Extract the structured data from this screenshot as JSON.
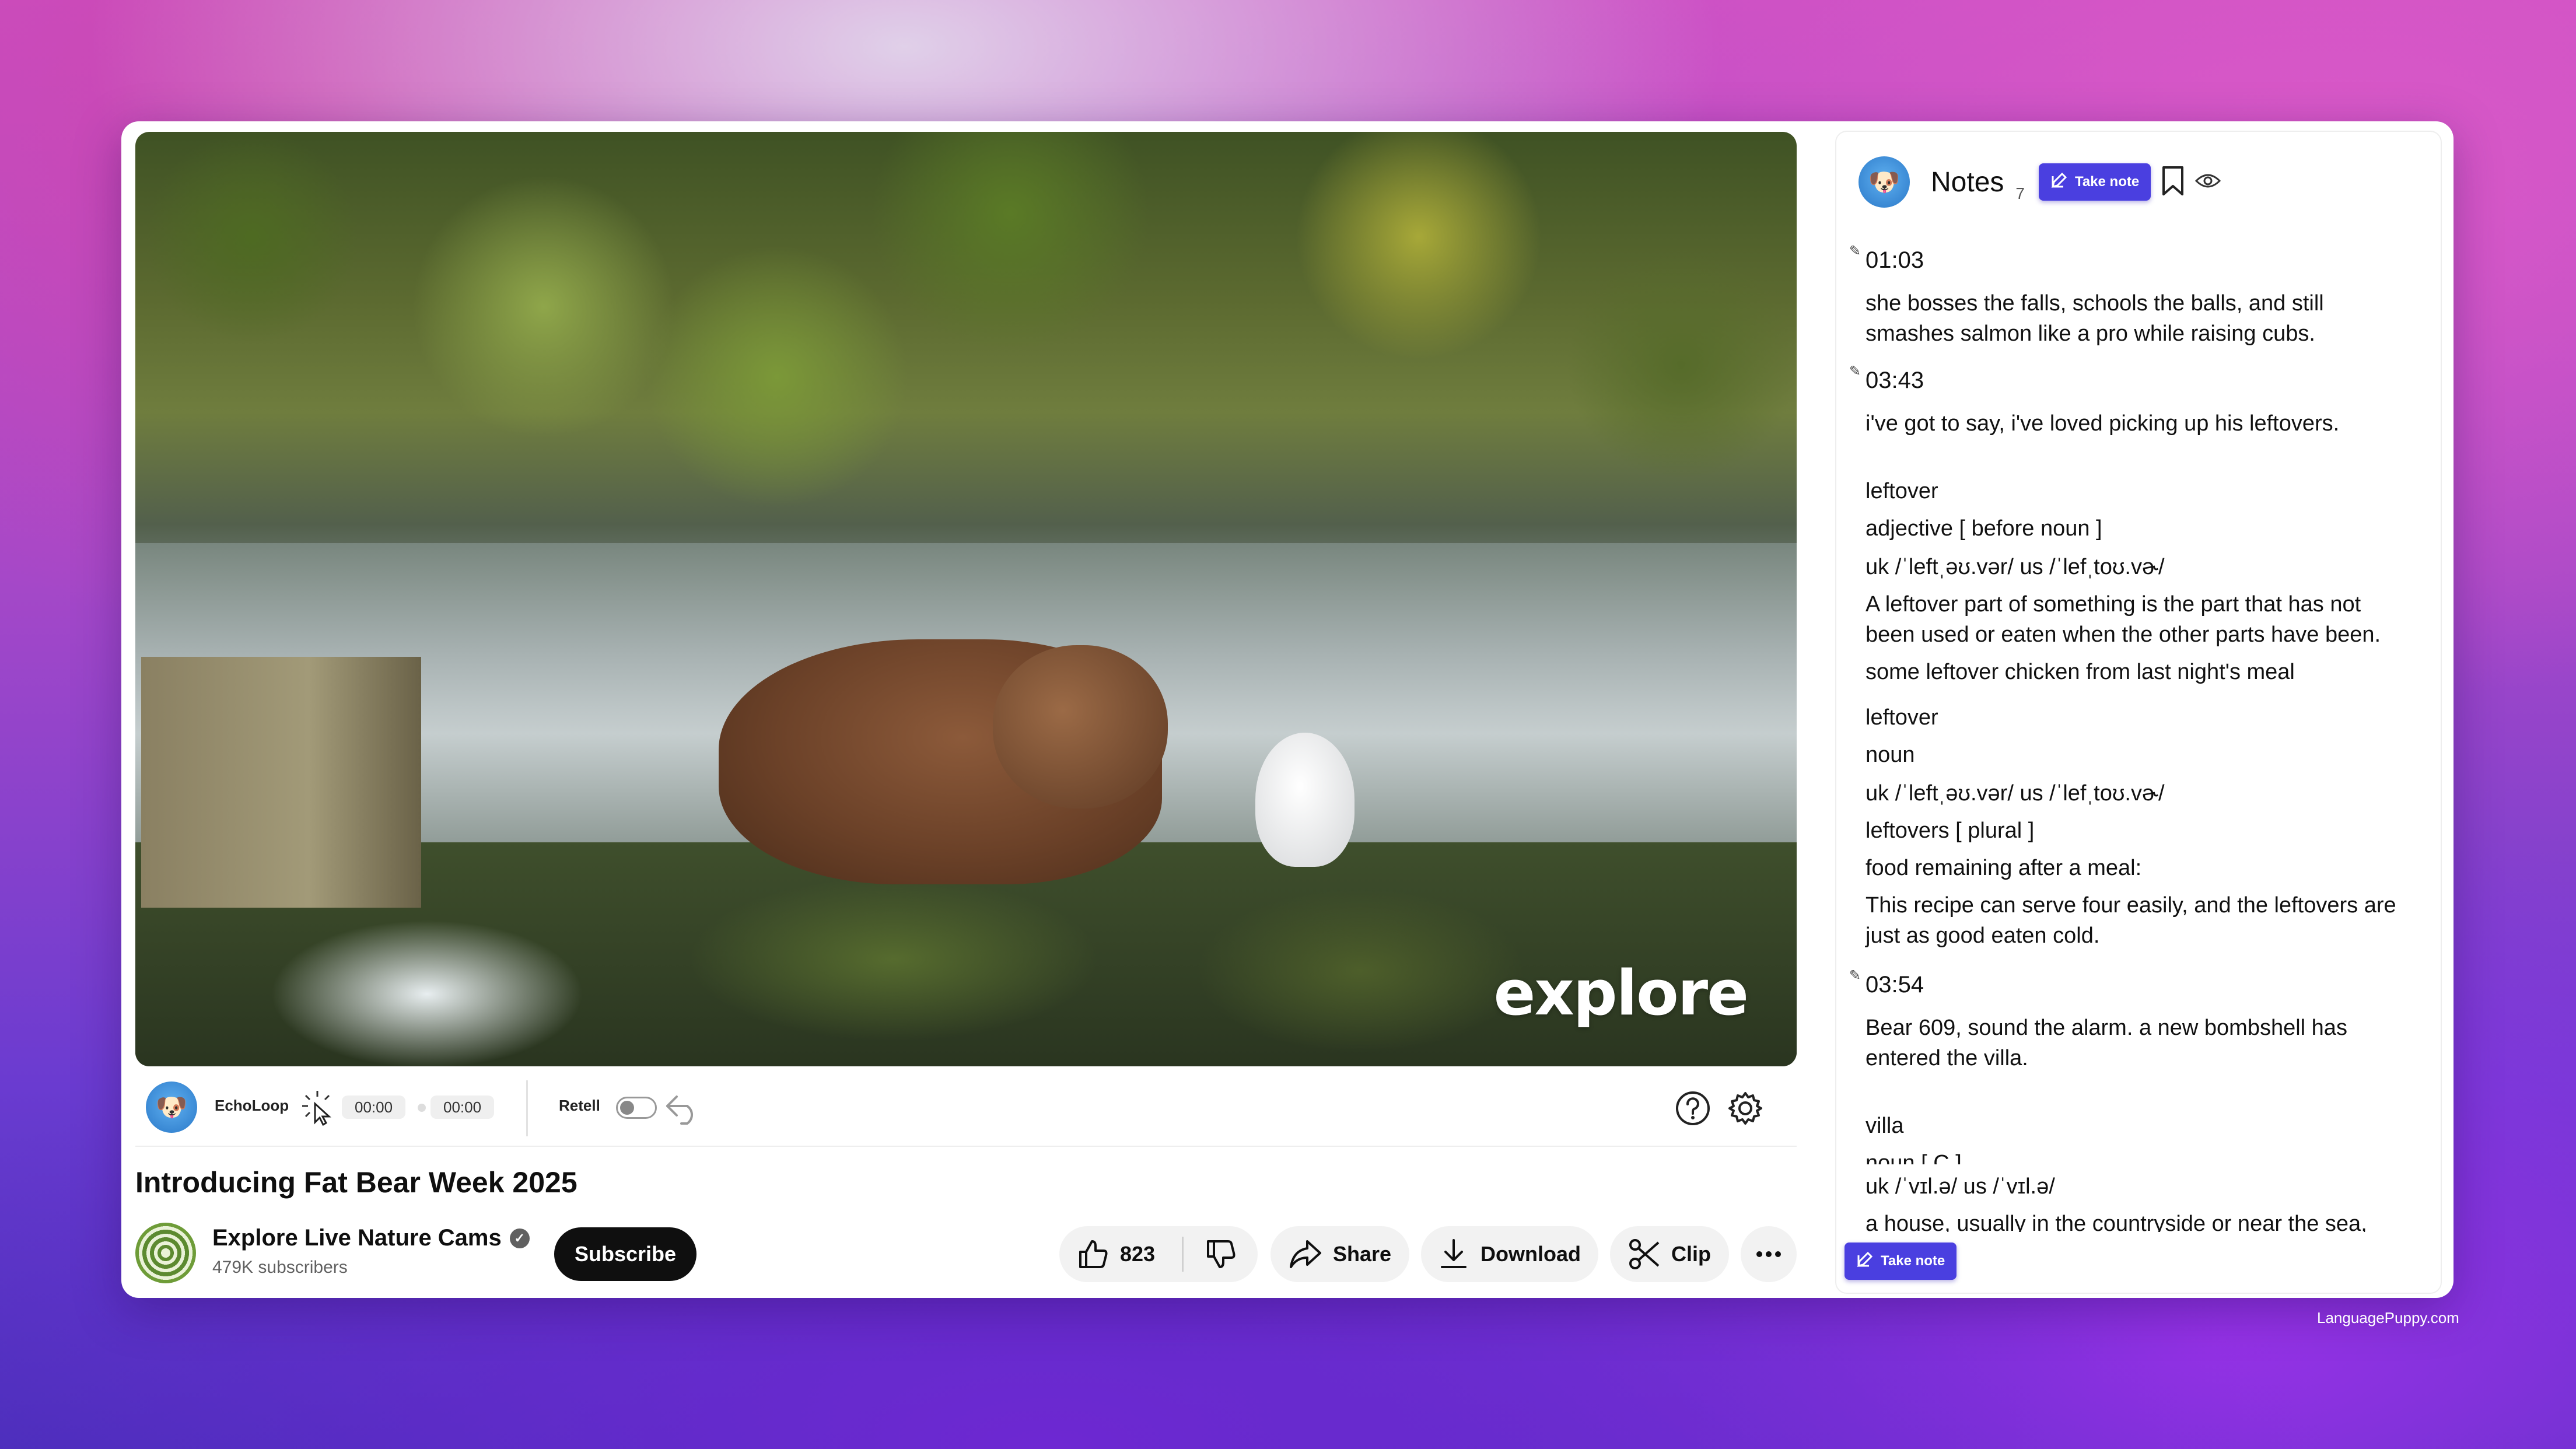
{
  "player": {
    "watermark": "explore",
    "echoloop_label": "EchoLoop",
    "time_start": "00:00",
    "time_end": "00:00",
    "retell_label": "Retell"
  },
  "video": {
    "title": "Introducing Fat Bear Week 2025"
  },
  "channel": {
    "name": "Explore Live Nature Cams",
    "subscribers": "479K subscribers",
    "subscribe_label": "Subscribe"
  },
  "actions": {
    "like_count": "823",
    "share_label": "Share",
    "download_label": "Download",
    "clip_label": "Clip"
  },
  "notes": {
    "title": "Notes",
    "count": "7",
    "take_note_label": "Take note",
    "entries": [
      {
        "type": "ts",
        "text": "01:03"
      },
      {
        "type": "line",
        "text": "she bosses the falls, schools the balls, and still"
      },
      {
        "type": "line",
        "text": "smashes salmon like a pro while raising cubs."
      },
      {
        "type": "ts",
        "text": "03:43"
      },
      {
        "type": "line",
        "text": "i've got to say, i've loved picking up his leftovers."
      },
      {
        "type": "line",
        "text": "leftover"
      },
      {
        "type": "line",
        "text": "adjective [ before noun ]"
      },
      {
        "type": "line",
        "text": "uk /ˈleftˌəʊ.vər/ us /ˈlefˌtoʊ.vɚ/"
      },
      {
        "type": "line",
        "text": "A leftover part of something is the part that has not"
      },
      {
        "type": "line",
        "text": "been used or eaten when the other parts have been."
      },
      {
        "type": "line",
        "text": "some leftover chicken from last night's meal"
      },
      {
        "type": "line",
        "text": "leftover"
      },
      {
        "type": "line",
        "text": "noun"
      },
      {
        "type": "line",
        "text": "uk /ˈleftˌəʊ.vər/ us /ˈlefˌtoʊ.vɚ/"
      },
      {
        "type": "line",
        "text": "leftovers [ plural ]"
      },
      {
        "type": "line",
        "text": "food remaining after a meal:"
      },
      {
        "type": "line",
        "text": "This recipe can serve four easily, and the leftovers are"
      },
      {
        "type": "line",
        "text": "just as good eaten cold."
      },
      {
        "type": "ts",
        "text": "03:54"
      },
      {
        "type": "line",
        "text": "Bear 609, sound the alarm. a new bombshell has"
      },
      {
        "type": "line",
        "text": "entered the villa."
      },
      {
        "type": "line",
        "text": "villa"
      },
      {
        "type": "line",
        "text": "noun [ C ]"
      },
      {
        "type": "line",
        "text": "uk /ˈvɪl.ə/ us /ˈvɪl.ə/"
      },
      {
        "type": "line",
        "text": "a house, usually in the countryside or near the sea,"
      }
    ]
  },
  "footer": {
    "credit": "LanguagePuppy.com"
  },
  "colors": {
    "accent": "#4a3fe0",
    "subscribe_bg": "#0f0f0f",
    "pill_bg": "#f2f2f2"
  },
  "icons": [
    "echoloop-avatar-icon",
    "cursor-sparkle-icon",
    "undo-icon",
    "help-icon",
    "settings-icon",
    "thumbs-up-icon",
    "thumbs-down-icon",
    "share-icon",
    "download-icon",
    "scissors-icon",
    "more-icon",
    "edit-icon",
    "bookmark-icon",
    "eye-icon",
    "verified-icon"
  ]
}
